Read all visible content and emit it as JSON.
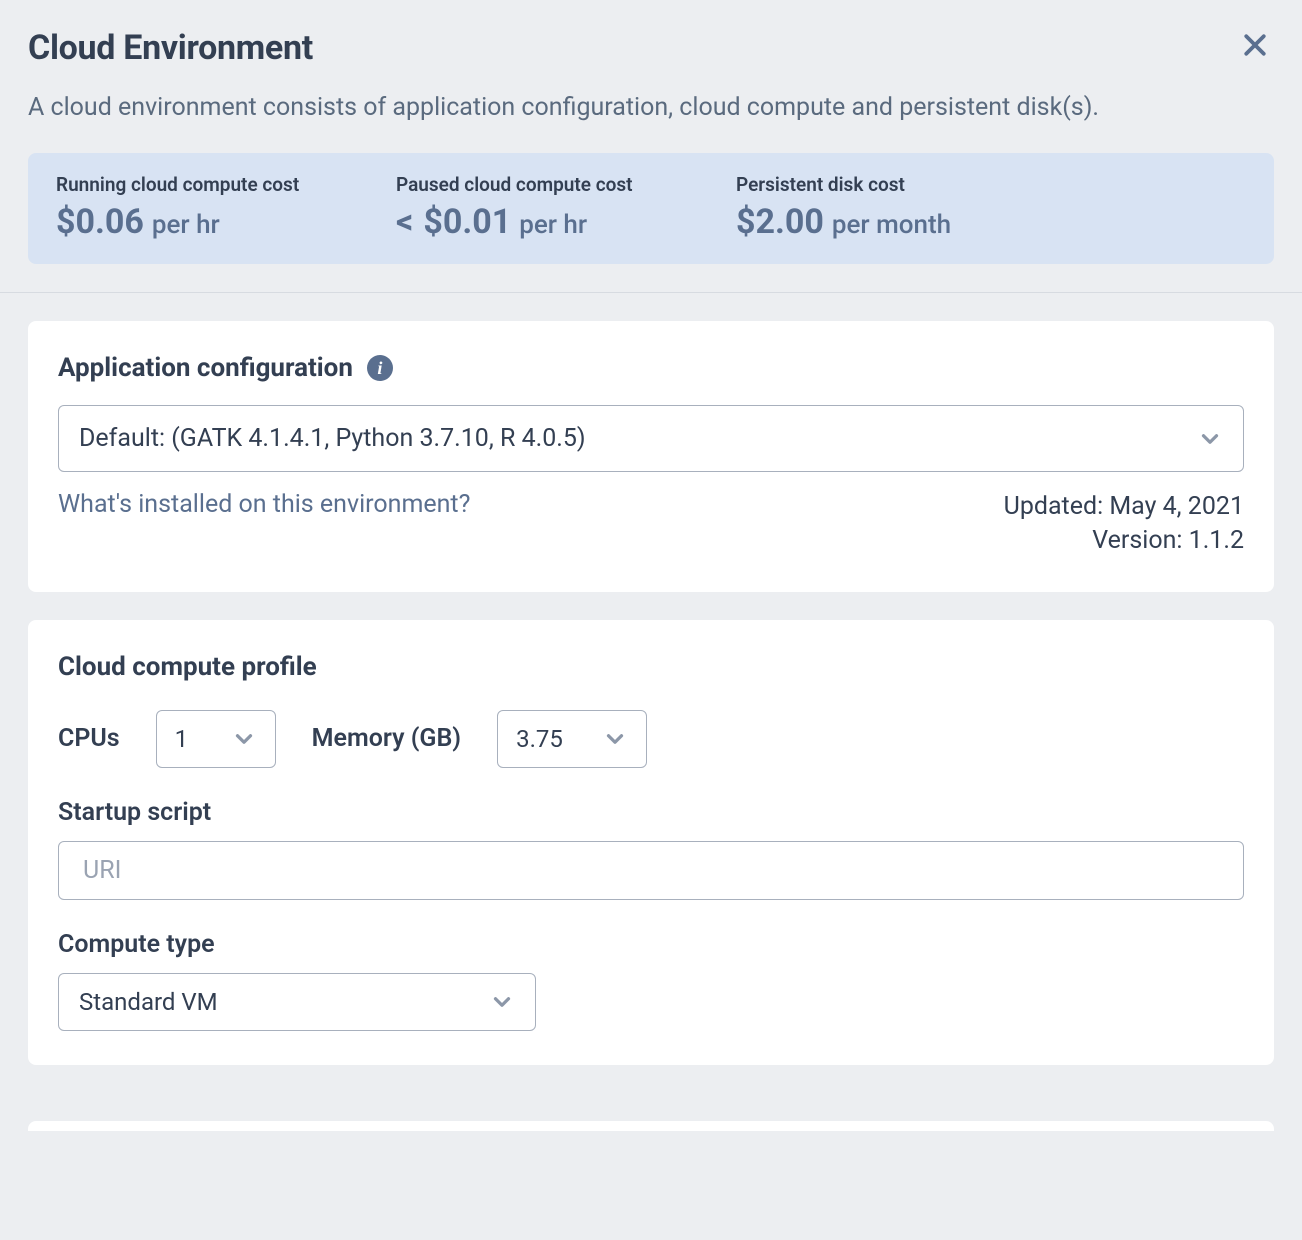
{
  "header": {
    "title": "Cloud Environment",
    "subtitle": "A cloud environment consists of application configuration, cloud compute and persistent disk(s)."
  },
  "costs": {
    "running": {
      "label": "Running cloud compute cost",
      "amount": "$0.06",
      "unit": "per hr"
    },
    "paused": {
      "label": "Paused cloud compute cost",
      "prefix": "<",
      "amount": "$0.01",
      "unit": "per hr"
    },
    "disk": {
      "label": "Persistent disk cost",
      "amount": "$2.00",
      "unit": "per month"
    }
  },
  "appConfig": {
    "heading": "Application configuration",
    "selected": "Default: (GATK 4.1.4.1, Python 3.7.10, R 4.0.5)",
    "installedLink": "What's installed on this environment?",
    "updated": "Updated: May 4, 2021",
    "version": "Version: 1.1.2"
  },
  "computeProfile": {
    "heading": "Cloud compute profile",
    "cpusLabel": "CPUs",
    "cpusValue": "1",
    "memoryLabel": "Memory (GB)",
    "memoryValue": "3.75",
    "startupLabel": "Startup script",
    "startupPlaceholder": "URI",
    "startupValue": "",
    "computeTypeLabel": "Compute type",
    "computeTypeValue": "Standard VM"
  }
}
